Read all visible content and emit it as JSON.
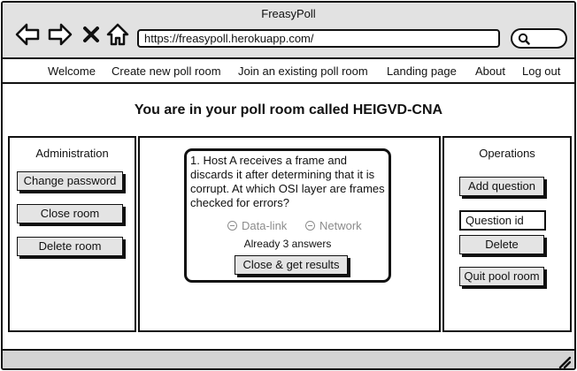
{
  "window": {
    "title": "FreasyPoll"
  },
  "browser": {
    "url": "https://freasypoll.herokuapp.com/"
  },
  "menu": {
    "items": [
      {
        "label": "Welcome"
      },
      {
        "label": "Create new poll room"
      },
      {
        "label": "Join an existing poll room"
      },
      {
        "label": "Landing page"
      },
      {
        "label": "About"
      },
      {
        "label": "Log out"
      }
    ]
  },
  "page": {
    "title": "You are in your poll room called HEIGVD-CNA"
  },
  "administration": {
    "title": "Administration",
    "buttons": [
      {
        "label": "Change password"
      },
      {
        "label": "Close room"
      },
      {
        "label": "Delete room"
      }
    ]
  },
  "question": {
    "text": "1. Host A receives a frame and discards it after determining that it is corrupt. At which OSI layer are frames checked for errors?",
    "answers": [
      {
        "label": "Data-link"
      },
      {
        "label": "Network"
      }
    ],
    "answer_count": "Already 3 answers",
    "close_label": "Close & get results"
  },
  "operations": {
    "title": "Operations",
    "add_label": "Add question",
    "question_id_value": "Question id",
    "delete_label": "Delete",
    "quit_label": "Quit pool room"
  },
  "icons": {
    "back": "back-arrow-icon",
    "forward": "forward-arrow-icon",
    "stop": "close-icon",
    "home": "home-icon",
    "search": "search-icon",
    "resize": "resize-grip-icon"
  }
}
